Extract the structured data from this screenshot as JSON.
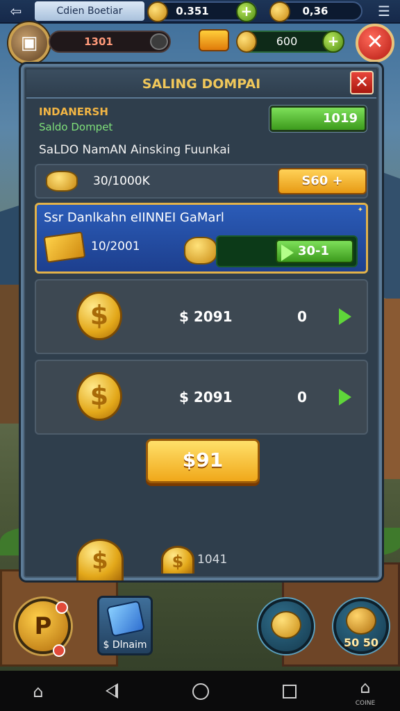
{
  "topbar": {
    "back_icon": "back-arrow-icon",
    "title": "Cdien Boetiar",
    "resource1_value": "0.351",
    "resource2_value": "0,36",
    "menu_icon": "menu-icon"
  },
  "hud": {
    "health_value": "1301",
    "coins_value": "600",
    "add_label": "+",
    "close_label": "✕"
  },
  "panel": {
    "title": "SALING DOMPAI",
    "close_label": "✕",
    "label_main": "INDANERSH",
    "label_sub": "Saldo Dompet",
    "balance_value": "1019",
    "heading": "SaLDO NamAN Ainsking Fuunkai",
    "row1": {
      "amount": "30/1000K",
      "button_label": "S60 +"
    },
    "highlight": {
      "title": "Ssr Danlkahn eIINNEI GaMarl",
      "amount": "10/2001",
      "button_label": "30-1"
    },
    "coin_rows": [
      {
        "price": "$ 2091",
        "count": "0"
      },
      {
        "price": "$ 2091",
        "count": "0"
      }
    ],
    "main_button": "$91",
    "bottom_amount": "1041"
  },
  "bottom_hud": {
    "p_label": "P",
    "gem_label": "Dlnaim",
    "gem_prefix": "$",
    "right_label": "50 50"
  },
  "navbar": {
    "extra_label": "COINE"
  },
  "colors": {
    "accent_gold": "#f0c75a",
    "accent_green": "#5fd63a",
    "panel_bg": "#2f3e4c",
    "highlight_blue": "#2b5cb8"
  }
}
